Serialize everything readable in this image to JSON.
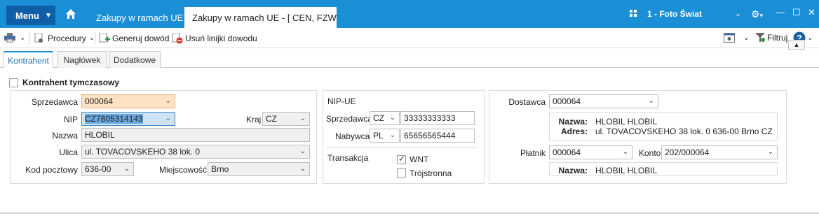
{
  "titlebar": {
    "menu_label": "Menu",
    "tabs": [
      {
        "label": "Zakupy w ramach UE"
      },
      {
        "label": "Zakupy w ramach UE - [ CEN, FZWN"
      }
    ],
    "company": "1 - Foto Świat",
    "accent": "#1b8fd6"
  },
  "toolbar": {
    "procedury": "Procedury",
    "generuj": "Generuj dowód",
    "usun": "Usuń linijki dowodu",
    "filtruj": "Filtruj"
  },
  "subtabs": [
    {
      "label": "Kontrahent"
    },
    {
      "label": "Nagłówek"
    },
    {
      "label": "Dodatkowe"
    }
  ],
  "form": {
    "temp_label": "Kontrahent tymczasowy",
    "left": {
      "sprzedawca_label": "Sprzedawca",
      "sprzedawca_value": "000064",
      "nip_label": "NIP",
      "nip_value": "CZ7805314143",
      "kraj_label": "Kraj",
      "kraj_value": "CZ",
      "nazwa_label": "Nazwa",
      "nazwa_value": "HLOBIL",
      "ulica_label": "Ulica",
      "ulica_value": "ul. TOVACOVSKEHO 38 lok. 0",
      "kod_label": "Kod pocztowy",
      "kod_value": "636-00",
      "miejscowosc_label": "Miejscowość",
      "miejscowosc_value": "Brno"
    },
    "mid": {
      "title": "NIP-UE",
      "sprzedawca_label": "Sprzedawca",
      "sprzedawca_country": "CZ",
      "sprzedawca_nip": "33333333333",
      "nabywca_label": "Nabywca",
      "nabywca_country": "PL",
      "nabywca_nip": "65656565444",
      "transakcja_label": "Transakcja",
      "wnt_label": "WNT",
      "trojstronna_label": "Trójstronna"
    },
    "right": {
      "dostawca_label": "Dostawca",
      "dostawca_value": "000064",
      "nazwa_label": "Nazwa:",
      "nazwa_value": "HLOBIL HLOBIL",
      "adres_label": "Adres:",
      "adres_value": "ul. TOVACOVSKEHO 38 lok. 0 636-00 Brno CZ",
      "platnik_label": "Płatnik",
      "platnik_value": "000064",
      "konto_label": "Konto",
      "konto_value": "202/000064",
      "nazwa2_label": "Nazwa:",
      "nazwa2_value": "HLOBIL HLOBIL"
    }
  }
}
